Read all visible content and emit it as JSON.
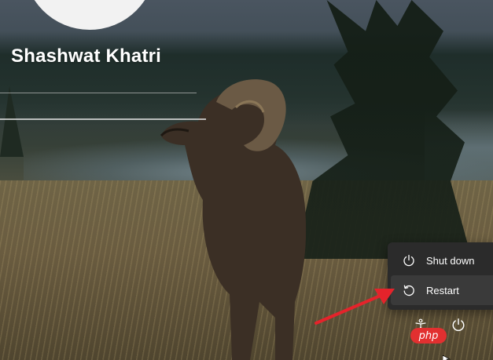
{
  "user": {
    "name": "Shashwat Khatri"
  },
  "power_menu": {
    "items": [
      {
        "label": "Shut down",
        "icon": "power-icon"
      },
      {
        "label": "Restart",
        "icon": "restart-icon"
      }
    ]
  },
  "system_buttons": {
    "accessibility_icon": "accessibility-icon",
    "power_icon": "power-icon"
  },
  "watermark": {
    "text": "php"
  },
  "colors": {
    "menu_bg": "#2b2b2b",
    "menu_hover": "#3a3a3a",
    "annotation_arrow": "#e5232b",
    "avatar": "#f2f2f2"
  }
}
